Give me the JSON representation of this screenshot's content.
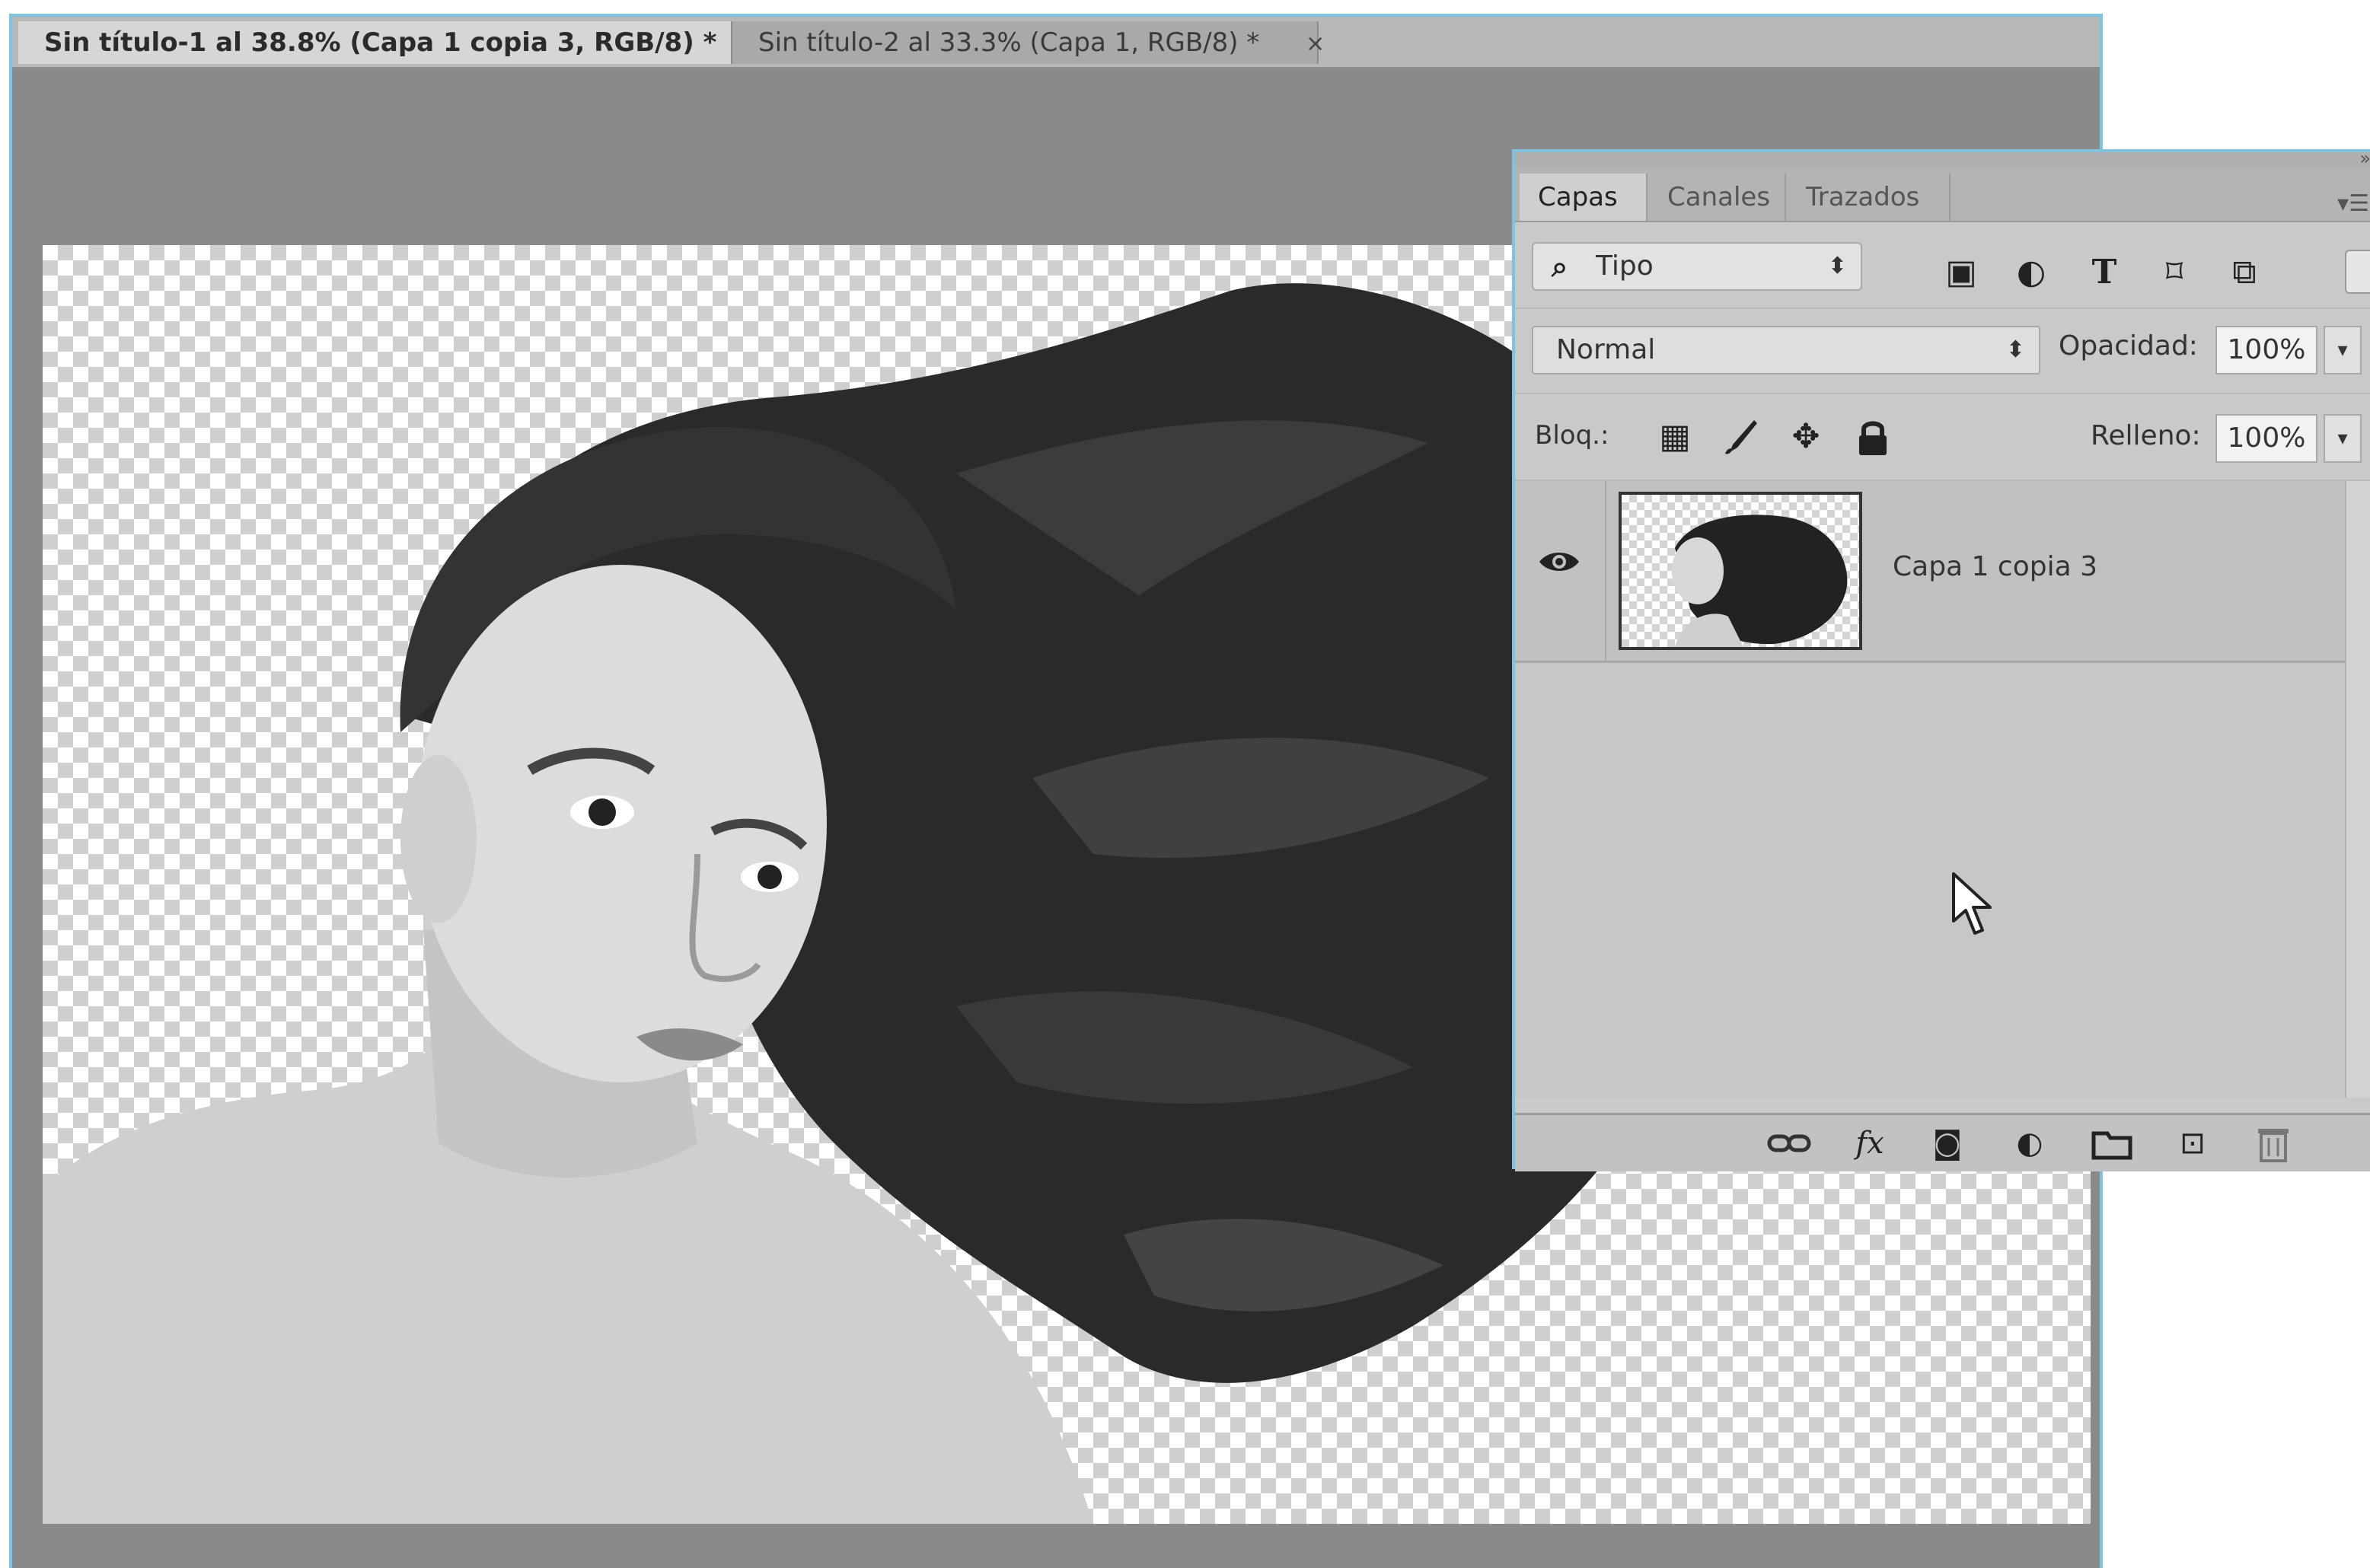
{
  "document_tabs": [
    {
      "label": "Sin título-1 al 38.8% (Capa 1 copia 3, RGB/8) *",
      "active": true,
      "close": "×"
    },
    {
      "label": "Sin título-2 al 33.3% (Capa 1, RGB/8) *",
      "active": false,
      "close": "×"
    }
  ],
  "layers_panel": {
    "tabs": [
      "Capas",
      "Canales",
      "Trazados"
    ],
    "active_tab": "Capas",
    "collapse": "»",
    "menu": "▾☰",
    "filter": {
      "value": "Tipo",
      "updown": "⬍"
    },
    "blend_mode": {
      "value": "Normal",
      "updown": "⬍"
    },
    "opacity": {
      "label": "Opacidad:",
      "value": "100%",
      "drop": "▾"
    },
    "lock": {
      "label": "Bloq.:"
    },
    "fill": {
      "label": "Relleno:",
      "value": "100%",
      "drop": "▾"
    },
    "layers": [
      {
        "name": "Capa 1 copia 3",
        "visible": true
      }
    ],
    "icons": {
      "search": "⌕",
      "filter_image": "▣",
      "filter_adjust": "◐",
      "filter_type": "T",
      "filter_shape": "⌑",
      "filter_smart": "⧉",
      "lock_pixels": "▦",
      "lock_brush": "⁄",
      "lock_move": "✥",
      "lock_all": "🔒",
      "eye": "👁",
      "link": "⊖",
      "fx": "fx",
      "mask": "◙",
      "adjust": "◐",
      "group": "🗀",
      "new": "⊡",
      "delete": "🗑"
    }
  },
  "colors": {
    "window_border": "#7ec3df",
    "workspace": "#8a8a8a",
    "panel_bg": "#c9c9c9"
  }
}
